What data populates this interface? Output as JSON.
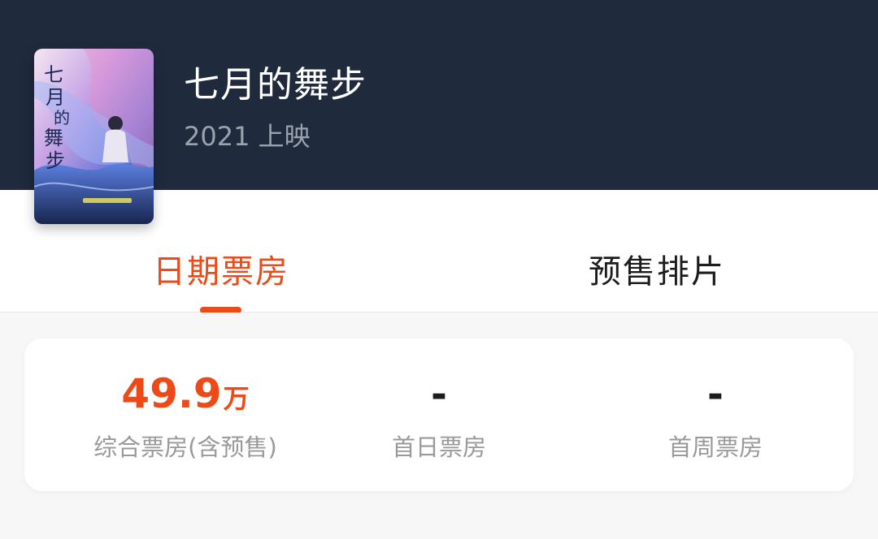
{
  "movie": {
    "title": "七月的舞步",
    "release": "2021 上映"
  },
  "tabs": [
    {
      "label": "日期票房",
      "active": true
    },
    {
      "label": "预售排片",
      "active": false
    }
  ],
  "stats": [
    {
      "value": "49.9",
      "unit": "万",
      "label": "综合票房(含预售)"
    },
    {
      "value": "-",
      "label": "首日票房"
    },
    {
      "value": "-",
      "label": "首周票房"
    }
  ],
  "colors": {
    "header_bg": "#1f2a3d",
    "accent": "#ee4a17",
    "text_dark": "#1c1c1c",
    "text_muted": "#999999"
  }
}
